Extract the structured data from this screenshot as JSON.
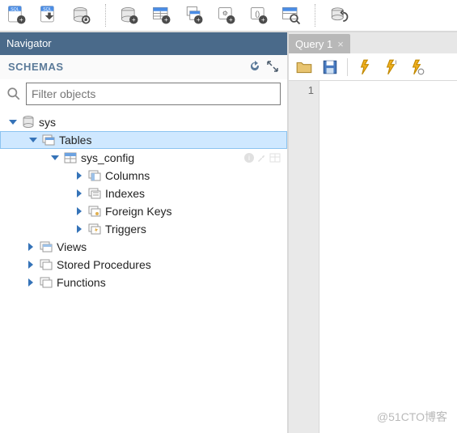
{
  "navigator": {
    "title": "Navigator"
  },
  "schemas_header": {
    "title": "SCHEMAS"
  },
  "filter": {
    "placeholder": "Filter objects"
  },
  "tree": {
    "db": {
      "label": "sys"
    },
    "tables": {
      "label": "Tables"
    },
    "table0": {
      "label": "sys_config"
    },
    "columns": {
      "label": "Columns"
    },
    "indexes": {
      "label": "Indexes"
    },
    "fkeys": {
      "label": "Foreign Keys"
    },
    "triggers": {
      "label": "Triggers"
    },
    "views": {
      "label": "Views"
    },
    "sprocs": {
      "label": "Stored Procedures"
    },
    "functions": {
      "label": "Functions"
    }
  },
  "query_tab": {
    "label": "Query 1"
  },
  "editor": {
    "line1": "1"
  },
  "watermark": "@51CTO博客"
}
